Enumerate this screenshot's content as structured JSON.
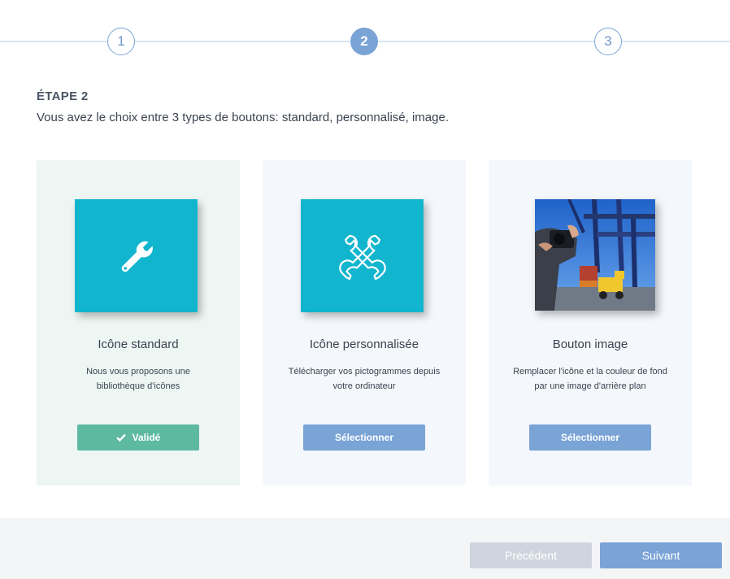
{
  "stepper": {
    "steps": [
      {
        "label": "1",
        "state": "default"
      },
      {
        "label": "2",
        "state": "active"
      },
      {
        "label": "3",
        "state": "default"
      }
    ],
    "active_color": "#7aa3d6"
  },
  "header": {
    "title": "ÉTAPE 2",
    "description": "Vous avez le choix entre 3 types de boutons: standard, personnalisé, image."
  },
  "cards": [
    {
      "title": "Icône standard",
      "description": "Nous vous proposons une bibliothèque d'icônes",
      "icon": "wrench-icon",
      "button_label": "Validé",
      "button_icon": "check-icon",
      "state": "selected"
    },
    {
      "title": "Icône personnalisée",
      "description": "Télécharger vos pictogrammes depuis votre ordinateur",
      "icon": "crossed-wrenches-icon",
      "button_label": "Sélectionner",
      "state": "default"
    },
    {
      "title": "Bouton image",
      "description": "Remplacer l'icône et la couleur de fond par une image d'arrière plan",
      "icon": "photo-thumbnail",
      "button_label": "Sélectionner",
      "state": "default"
    }
  ],
  "footer": {
    "prev_label": "Précédent",
    "next_label": "Suivant"
  },
  "colors": {
    "tile": "#11b5ce",
    "validated": "#5db9a2",
    "primary": "#7aa3d6",
    "disabled": "#cfd5de"
  }
}
